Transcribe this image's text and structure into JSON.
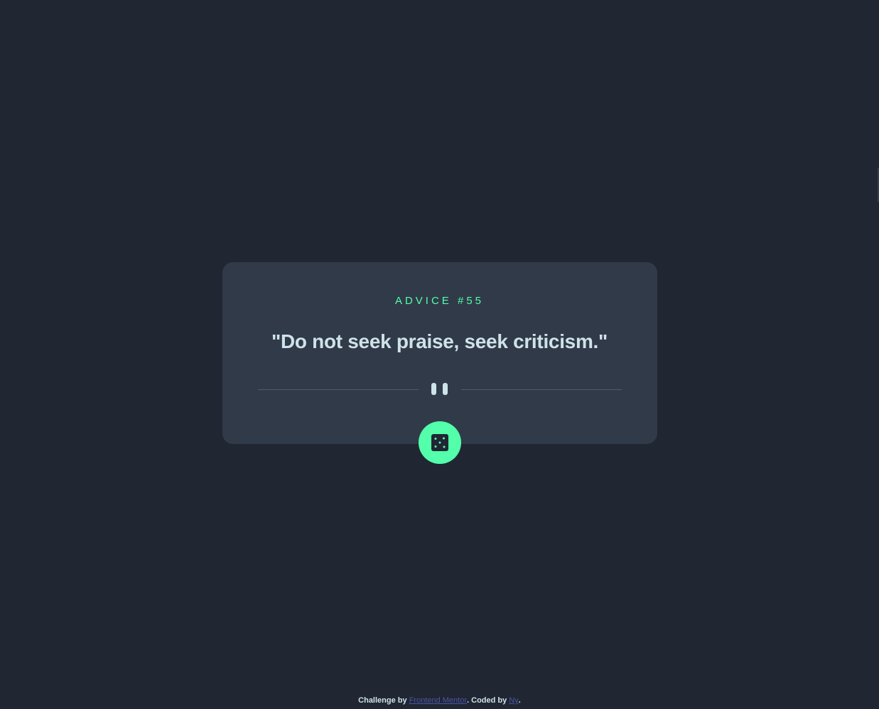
{
  "advice": {
    "label": "ADVICE #55",
    "text": "\"Do not seek praise, seek criticism.\""
  },
  "divider": {
    "icon": "pause-icon"
  },
  "dice_button": {
    "icon": "dice-icon"
  },
  "attribution": {
    "prefix": "Challenge by",
    "frontend_mentor_link": "Frontend Mentor",
    "middle": ". Coded by",
    "author_link": "Ny",
    "suffix": "."
  },
  "colors": {
    "background": "#202632",
    "card": "#313A48",
    "accent": "#53FFAA",
    "text": "#CEE3E9",
    "divider": "#4F5D74",
    "link": "#4A55A6"
  }
}
